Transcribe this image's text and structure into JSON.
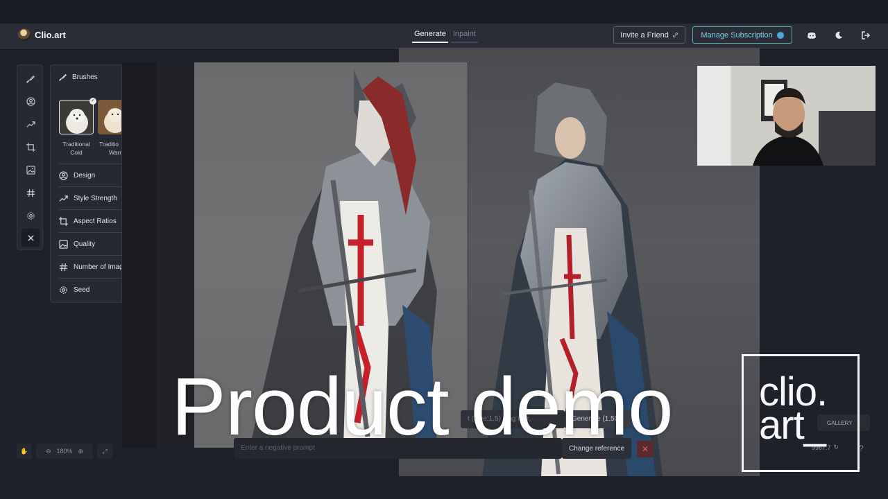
{
  "header": {
    "brand": "Clio.art",
    "tabs": [
      {
        "label": "Generate",
        "active": true
      },
      {
        "label": "Inpaint",
        "active": false
      }
    ],
    "invite_label": "Invite a Friend",
    "manage_label": "Manage Subscription",
    "icons": [
      "discord-icon",
      "moon-icon",
      "logout-icon"
    ]
  },
  "sidebar": {
    "tools": [
      "brush-icon",
      "user-circle-icon",
      "trend-icon",
      "crop-icon",
      "image-icon",
      "hash-icon",
      "gear-icon",
      "close-icon"
    ]
  },
  "panel": {
    "title": "Brushes",
    "brushes": [
      {
        "line1": "Traditional",
        "line2": "Cold",
        "selected": true
      },
      {
        "line1": "Traditio",
        "line2": "Warm",
        "selected": false
      }
    ],
    "settings": [
      "Design",
      "Style Strength",
      "Aspect Ratios",
      "Quality",
      "Number of Imag",
      "Seed"
    ]
  },
  "bottom": {
    "zoom": "180%",
    "prompt_fragment": "t (blue:1.5) long hair,",
    "generate_label": "Generate (1.50",
    "negative_placeholder": "Enter a negative prompt",
    "change_reference": "Change reference",
    "gallery": "GALLERY",
    "credits": "9967.7",
    "help": "?"
  },
  "overlay": {
    "caption": "Product demo",
    "brand_line1": "clio.",
    "brand_line2": "art_"
  },
  "colors": {
    "accent": "#4fb6a6",
    "accent_text": "#7fd3e6",
    "danger": "#e2585f"
  }
}
